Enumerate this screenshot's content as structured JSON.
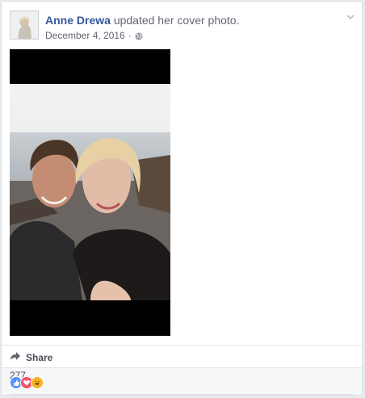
{
  "post": {
    "author": "Anne Drewa",
    "action": "updated her cover photo.",
    "date": "December 4, 2016",
    "separator": "·",
    "privacy_icon": "globe-icon",
    "menu_icon": "chevron-down-icon"
  },
  "actions": {
    "share_label": "Share",
    "share_icon": "share-arrow-icon"
  },
  "reactions": {
    "types": [
      "like",
      "love",
      "haha"
    ],
    "count": "277",
    "colors": {
      "like": "#5890ff",
      "love": "#f25268",
      "haha": "#f7b125"
    }
  },
  "colors": {
    "author_link": "#365899",
    "secondary_text": "#616770",
    "photo_letterbox": "#000000"
  }
}
